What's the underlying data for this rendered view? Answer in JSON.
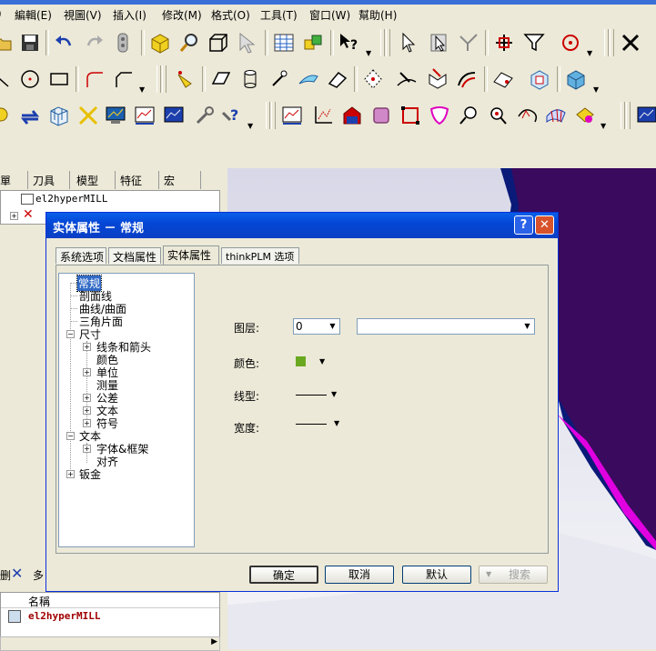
{
  "menubar": {
    "items": [
      "編輯(E)",
      "視圖(V)",
      "插入(I)",
      "修改(M)",
      "格式(O)",
      "工具(T)",
      "窗口(W)",
      "幫助(H)"
    ]
  },
  "left_panel": {
    "tabs": [
      "單",
      "刀具",
      "模型",
      "特征",
      "宏"
    ],
    "tree_top_item": "el2hyperMILL",
    "list_header": "名稱",
    "list_item": "el2hyperMILL"
  },
  "dialog": {
    "title": "实体属性 － 常规",
    "help_label": "?",
    "close_label": "✕",
    "tabs": [
      "系统选项",
      "文档属性",
      "实体属性",
      "thinkPLM 选项"
    ],
    "active_tab": "实体属性",
    "tree": {
      "general": "常规",
      "section_line": "剖面线",
      "curve_surface": "曲线/曲面",
      "triangle_patch": "三角片面",
      "dimension": "尺寸",
      "lines_arrows": "线条和箭头",
      "color": "颜色",
      "unit": "单位",
      "measure": "测量",
      "tolerance": "公差",
      "text": "文本",
      "symbol": "符号",
      "text_root": "文本",
      "font_frame": "字体&框架",
      "align": "对齐",
      "sheet_metal": "钣金"
    },
    "fields": {
      "layer_label": "图层:",
      "layer_value": "0",
      "color_label": "颜色:",
      "color_value": "#6aa820",
      "linetype_label": "线型:",
      "width_label": "宽度:"
    },
    "buttons": {
      "ok": "确定",
      "cancel": "取消",
      "default": "默认",
      "search": "搜索"
    }
  }
}
